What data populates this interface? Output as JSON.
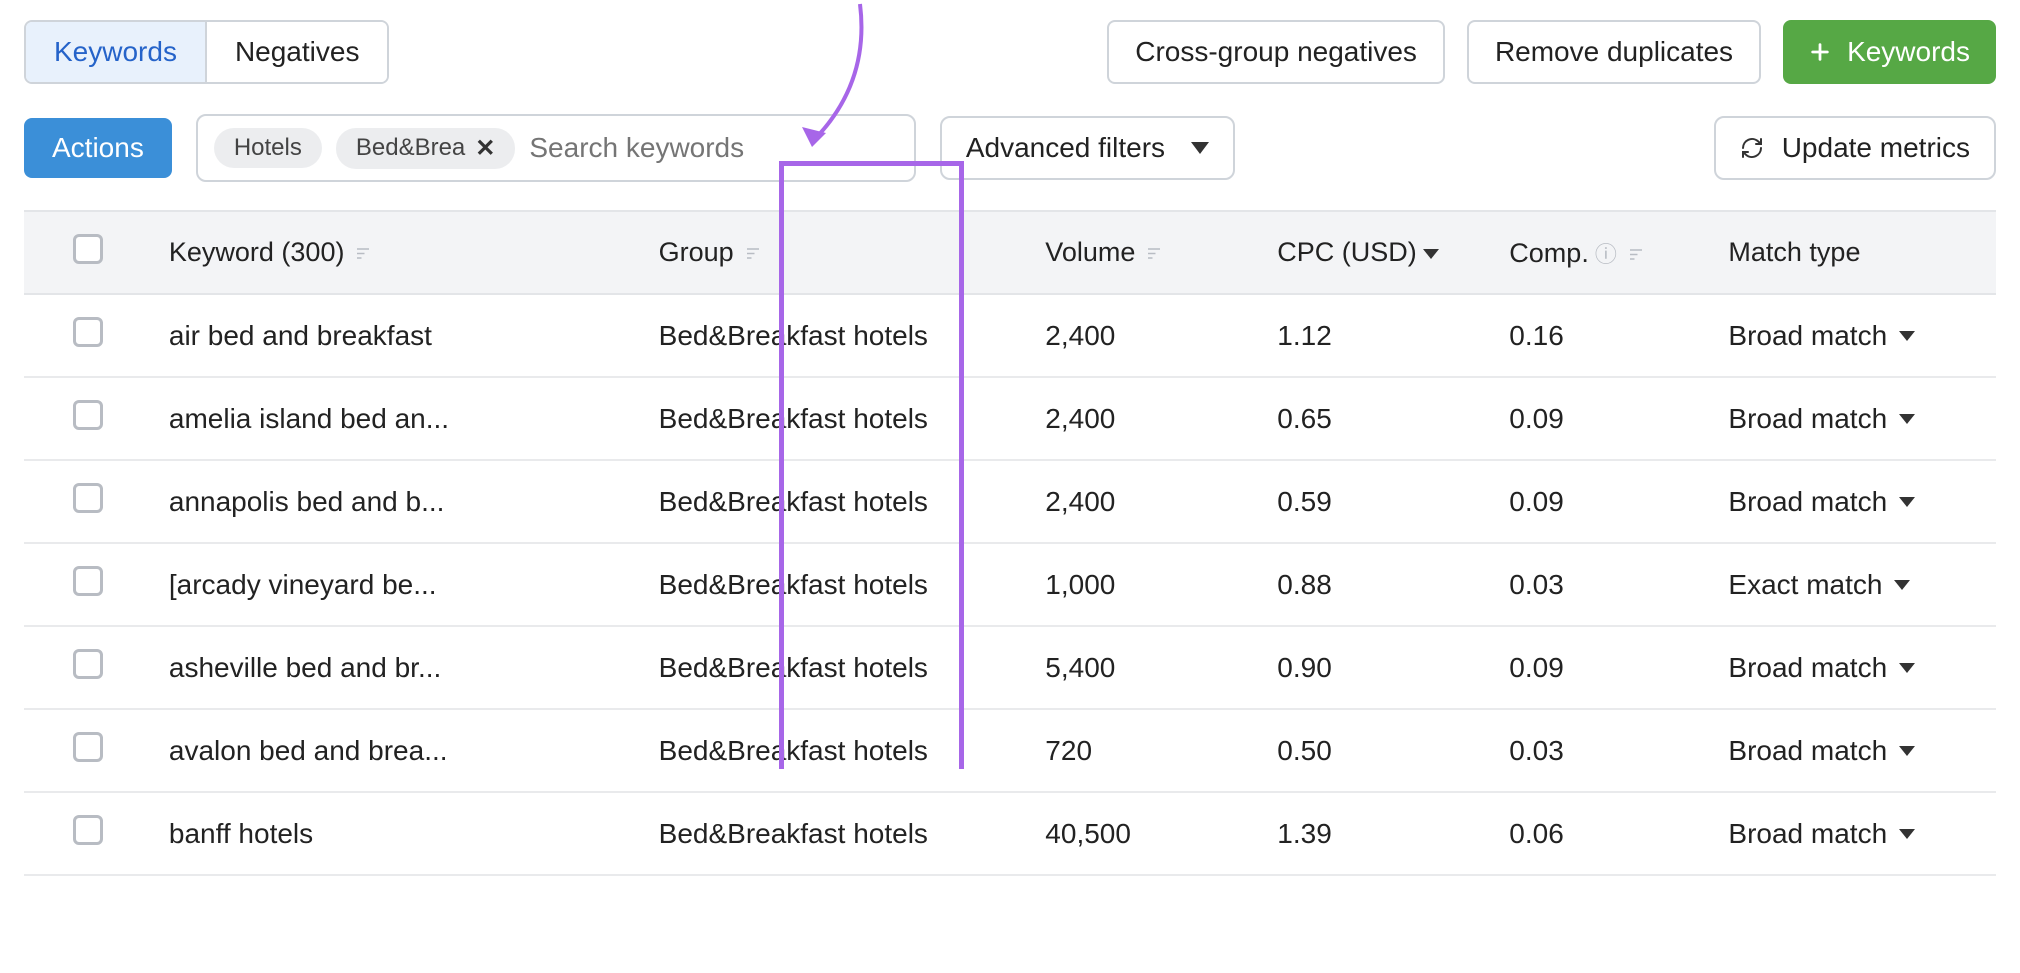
{
  "tabs": {
    "keywords": "Keywords",
    "negatives": "Negatives"
  },
  "top": {
    "cross": "Cross-group negatives",
    "remdup": "Remove duplicates",
    "addkw": "Keywords"
  },
  "actions": "Actions",
  "chips": {
    "c0": "Hotels",
    "c1": "Bed&Brea"
  },
  "search": {
    "placeholder": "Search keywords"
  },
  "adv": "Advanced filters",
  "update": "Update metrics",
  "cols": {
    "kw": "Keyword (300)",
    "gp": "Group",
    "vol": "Volume",
    "cpc": "CPC (USD)",
    "comp": "Comp.",
    "mt": "Match type"
  },
  "rows": [
    {
      "kw": "air bed and breakfast",
      "gp": "Bed&Breakfast hotels",
      "vol": "2,400",
      "cpc": "1.12",
      "comp": "0.16",
      "mt": "Broad match"
    },
    {
      "kw": "amelia island bed an...",
      "gp": "Bed&Breakfast hotels",
      "vol": "2,400",
      "cpc": "0.65",
      "comp": "0.09",
      "mt": "Broad match"
    },
    {
      "kw": "annapolis bed and b...",
      "gp": "Bed&Breakfast hotels",
      "vol": "2,400",
      "cpc": "0.59",
      "comp": "0.09",
      "mt": "Broad match"
    },
    {
      "kw": "[arcady vineyard be...",
      "gp": "Bed&Breakfast hotels",
      "vol": "1,000",
      "cpc": "0.88",
      "comp": "0.03",
      "mt": "Exact match"
    },
    {
      "kw": "asheville bed and br...",
      "gp": "Bed&Breakfast hotels",
      "vol": "5,400",
      "cpc": "0.90",
      "comp": "0.09",
      "mt": "Broad match"
    },
    {
      "kw": "avalon bed and brea...",
      "gp": "Bed&Breakfast hotels",
      "vol": "720",
      "cpc": "0.50",
      "comp": "0.03",
      "mt": "Broad match"
    },
    {
      "kw": "banff hotels",
      "gp": "Bed&Breakfast hotels",
      "vol": "40,500",
      "cpc": "1.39",
      "comp": "0.06",
      "mt": "Broad match"
    }
  ]
}
